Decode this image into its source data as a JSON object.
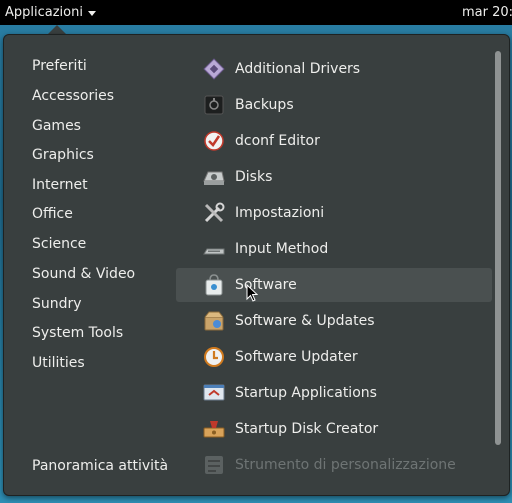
{
  "topbar": {
    "activities_label": "Applicazioni",
    "clock": "mar 20:"
  },
  "categories": [
    "Preferiti",
    "Accessories",
    "Games",
    "Graphics",
    "Internet",
    "Office",
    "Science",
    "Sound & Video",
    "Sundry",
    "System Tools",
    "Utilities"
  ],
  "overview_label": "Panoramica attività",
  "apps": [
    {
      "label": "Additional Drivers",
      "icon": "chip-icon"
    },
    {
      "label": "Backups",
      "icon": "safe-icon"
    },
    {
      "label": "dconf Editor",
      "icon": "checkmark-icon"
    },
    {
      "label": "Disks",
      "icon": "disk-icon"
    },
    {
      "label": "Impostazioni",
      "icon": "tools-icon"
    },
    {
      "label": "Input Method",
      "icon": "keyboard-icon"
    },
    {
      "label": "Software",
      "icon": "shopping-bag-icon"
    },
    {
      "label": "Software & Updates",
      "icon": "software-sources-icon"
    },
    {
      "label": "Software Updater",
      "icon": "update-icon"
    },
    {
      "label": "Startup Applications",
      "icon": "startup-icon"
    },
    {
      "label": "Startup Disk Creator",
      "icon": "usb-creator-icon"
    },
    {
      "label": "Strumento di personalizzazione",
      "icon": "tweak-tool-icon"
    }
  ]
}
